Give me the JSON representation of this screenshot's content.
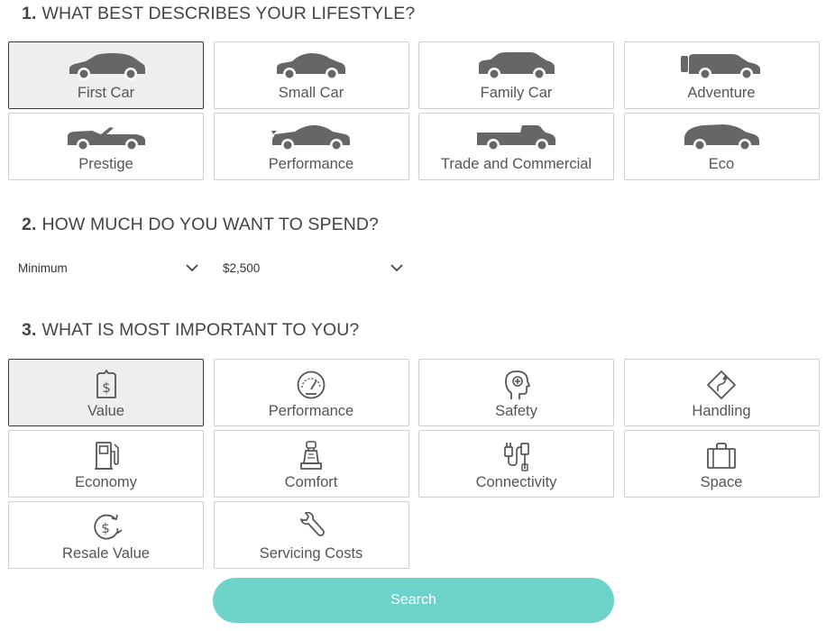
{
  "section1": {
    "number": "1.",
    "title": "WHAT BEST DESCRIBES YOUR LIFESTYLE?"
  },
  "lifestyle": [
    {
      "label": "First Car",
      "icon": "hatchback-car-icon",
      "selected": true
    },
    {
      "label": "Small Car",
      "icon": "small-car-icon",
      "selected": false
    },
    {
      "label": "Family Car",
      "icon": "suv-icon",
      "selected": false
    },
    {
      "label": "Adventure",
      "icon": "4wd-icon",
      "selected": false
    },
    {
      "label": "Prestige",
      "icon": "convertible-icon",
      "selected": false
    },
    {
      "label": "Performance",
      "icon": "sports-car-icon",
      "selected": false
    },
    {
      "label": "Trade and Commercial",
      "icon": "ute-icon",
      "selected": false
    },
    {
      "label": "Eco",
      "icon": "eco-car-icon",
      "selected": false
    }
  ],
  "section2": {
    "number": "2.",
    "title": "HOW MUCH DO YOU WANT TO SPEND?"
  },
  "budget": {
    "min": "Minimum",
    "max": "$2,500"
  },
  "section3": {
    "number": "3.",
    "title": "WHAT IS MOST IMPORTANT TO YOU?"
  },
  "importance": [
    {
      "label": "Value",
      "icon": "price-tag-icon",
      "selected": true
    },
    {
      "label": "Performance",
      "icon": "speedometer-icon",
      "selected": false
    },
    {
      "label": "Safety",
      "icon": "head-plus-icon",
      "selected": false
    },
    {
      "label": "Handling",
      "icon": "winding-road-sign-icon",
      "selected": false
    },
    {
      "label": "Economy",
      "icon": "fuel-pump-icon",
      "selected": false
    },
    {
      "label": "Comfort",
      "icon": "car-seat-icon",
      "selected": false
    },
    {
      "label": "Connectivity",
      "icon": "cable-plug-icon",
      "selected": false
    },
    {
      "label": "Space",
      "icon": "suitcase-icon",
      "selected": false
    },
    {
      "label": "Resale Value",
      "icon": "dollar-cycle-icon",
      "selected": false
    },
    {
      "label": "Servicing Costs",
      "icon": "wrench-icon",
      "selected": false
    }
  ],
  "search_label": "Search",
  "colors": {
    "accent": "#6dd3c9",
    "selected_bg": "#eeeeee",
    "icon": "#666666"
  }
}
